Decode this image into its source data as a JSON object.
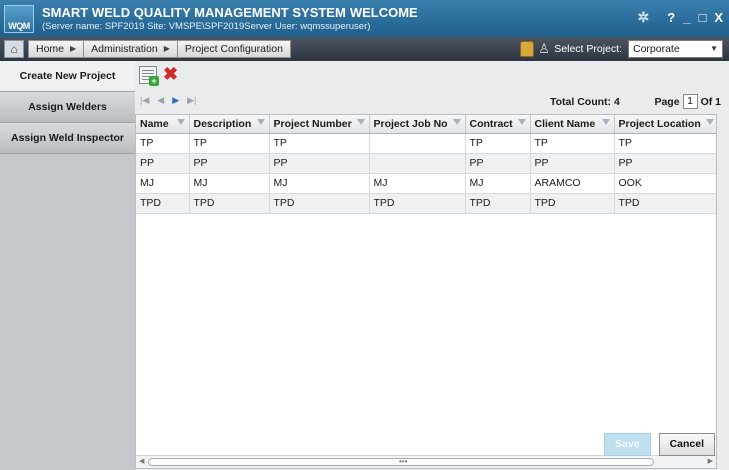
{
  "window": {
    "logo_text": "WQM",
    "title": "SMART WELD QUALITY MANAGEMENT SYSTEM",
    "welcome": "WELCOME",
    "server_info": "(Server name: SPF2019 Site: VMSPE\\SPF2019Server User: wqmssuperuser)",
    "controls": {
      "help": "?",
      "minimize": "_",
      "maximize": "□",
      "close": "X"
    }
  },
  "nav": {
    "breadcrumbs": [
      "Home",
      "Administration",
      "Project Configuration"
    ],
    "select_project_label": "Select Project:",
    "selected_project": "Corporate"
  },
  "sidebar": {
    "items": [
      {
        "label": "Create New Project",
        "active": true
      },
      {
        "label": "Assign Welders",
        "active": false
      },
      {
        "label": "Assign Weld Inspector",
        "active": false
      }
    ]
  },
  "pager": {
    "total_label": "Total Count:",
    "total_value": "4",
    "page_label": "Page",
    "page_value": "1",
    "of_label": "Of 1"
  },
  "grid": {
    "columns": [
      "Name",
      "Description",
      "Project Number",
      "Project Job No",
      "Contract",
      "Client Name",
      "Project Location"
    ],
    "rows": [
      [
        "TP",
        "TP",
        "TP",
        "",
        "TP",
        "TP",
        "TP"
      ],
      [
        "PP",
        "PP",
        "PP",
        "",
        "PP",
        "PP",
        "PP"
      ],
      [
        "MJ",
        "MJ",
        "MJ",
        "MJ",
        "MJ",
        "ARAMCO",
        "OOK"
      ],
      [
        "TPD",
        "TPD",
        "TPD",
        "TPD",
        "TPD",
        "TPD",
        "TPD"
      ]
    ]
  },
  "buttons": {
    "save": "Save",
    "cancel": "Cancel"
  },
  "colors": {
    "title_bar": "#1f5f8c",
    "nav_bar": "#2e363f",
    "sidebar": "#c4c8cc",
    "delete": "#d2282a",
    "add": "#3aa23a"
  }
}
